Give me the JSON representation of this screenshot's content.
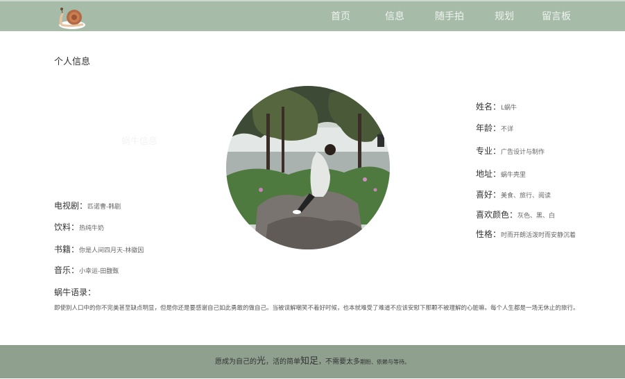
{
  "nav": {
    "items": [
      {
        "label": "首页"
      },
      {
        "label": "信息"
      },
      {
        "label": "随手拍"
      },
      {
        "label": "规划"
      },
      {
        "label": "留言板"
      }
    ]
  },
  "page_title": "个人信息",
  "watermark": "蜗牛信息",
  "left_info": [
    {
      "label": "电视剧：",
      "value": "匹诺曹-韩剧"
    },
    {
      "label": "饮料：",
      "value": "热纯牛奶"
    },
    {
      "label": "书籍：",
      "value": "你是人间四月天-林徽因"
    },
    {
      "label": "音乐：",
      "value": "小幸运-田馥甄"
    }
  ],
  "right_info": [
    {
      "label": "姓名：",
      "value": "L蜗牛"
    },
    {
      "label": "年龄：",
      "value": "不详"
    },
    {
      "label": "专业：",
      "value": "广告设计与制作"
    },
    {
      "label": "地址：",
      "value": "蜗牛壳里"
    },
    {
      "label": "喜好：",
      "value": "美食、旅行、阅读"
    },
    {
      "label": "喜欢颜色：",
      "value": "灰色、黑、白"
    },
    {
      "label": "性格：",
      "value": "时而开朗活泼时而安静沉着"
    }
  ],
  "quote": {
    "title": "蜗牛语录：",
    "text": "即使别人口中的你不完美甚至缺点明显，但是你还是要感谢自己如此勇敢的做自己。当被误解嘲笑不着好时候，也本就难受了难道不应该安慰下那颗不被理解的心脏嘛。每个人生都是一场无休止的旅行。"
  },
  "footer": {
    "part1": "愿成为自己的",
    "part2": "光",
    "part3": "，活的简单",
    "part4": "知足",
    "part5": "，不需要太多",
    "part6": "期盼、依赖与等待。"
  },
  "colors": {
    "header": "#a7bba9",
    "footer": "#8fa08f",
    "nav_text": "#eef3ee"
  },
  "icons": {
    "logo": "snail-logo-icon",
    "avatar": "profile-photo"
  }
}
